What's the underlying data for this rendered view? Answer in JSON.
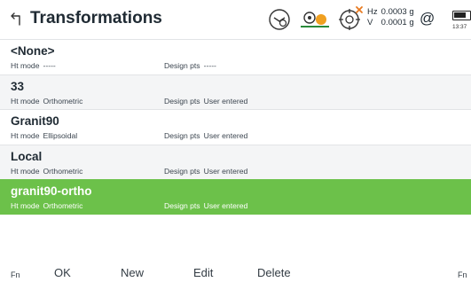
{
  "header": {
    "title": "Transformations",
    "hz_label": "Hz",
    "hz_value": "0.0003 g",
    "v_label": "V",
    "v_value": "0.0001 g",
    "at_symbol": "@",
    "clock": "13:37"
  },
  "list": {
    "rows": [
      {
        "name": "<None>",
        "ht_label": "Ht mode",
        "ht_value": "-----",
        "dp_label": "Design pts",
        "dp_value": "-----"
      },
      {
        "name": "33",
        "ht_label": "Ht mode",
        "ht_value": "Orthometric",
        "dp_label": "Design pts",
        "dp_value": "User entered"
      },
      {
        "name": "Granit90",
        "ht_label": "Ht mode",
        "ht_value": "Ellipsoidal",
        "dp_label": "Design pts",
        "dp_value": "User entered"
      },
      {
        "name": "Local",
        "ht_label": "Ht mode",
        "ht_value": "Orthometric",
        "dp_label": "Design pts",
        "dp_value": "User entered"
      },
      {
        "name": "granit90-ortho",
        "ht_label": "Ht mode",
        "ht_value": "Orthometric",
        "dp_label": "Design pts",
        "dp_value": "User entered"
      }
    ],
    "selected_color": "#6cc14a"
  },
  "toolbar": {
    "fn_left": "Fn",
    "ok": "OK",
    "new": "New",
    "edit": "Edit",
    "delete": "Delete",
    "fn_right": "Fn"
  },
  "icons": [
    "back-icon",
    "tilt-status-icon",
    "satellite-status-icon",
    "target-status-icon",
    "at-icon",
    "battery-icon"
  ]
}
